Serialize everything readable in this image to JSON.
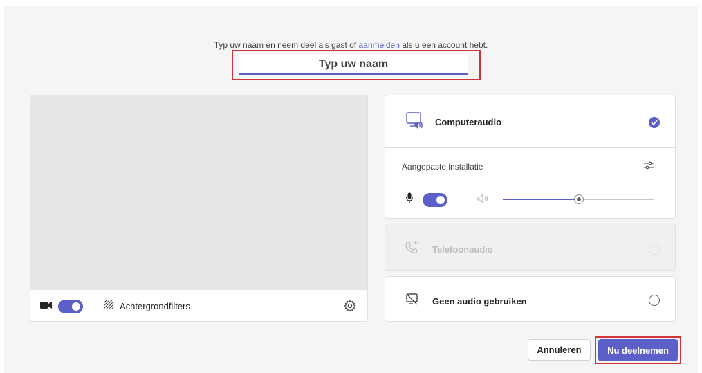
{
  "intro": {
    "before": "Typ uw naam en neem deel als gast of ",
    "link": "aanmelden",
    "after": " als u een account hebt."
  },
  "name_input": {
    "placeholder": "Typ uw naam",
    "value": ""
  },
  "video": {
    "camera_toggle_on": true,
    "background_filters_label": "Achtergrondfilters"
  },
  "audio": {
    "computer": {
      "label": "Computeraudio",
      "selected": true
    },
    "custom_setup_label": "Aangepaste installatie",
    "mic_toggle_on": true,
    "speaker_volume": 0.5,
    "phone": {
      "label": "Telefoonaudio",
      "disabled": true
    },
    "none": {
      "label": "Geen audio gebruiken",
      "selected": false
    }
  },
  "buttons": {
    "cancel": "Annuleren",
    "join": "Nu deelnemen"
  },
  "colors": {
    "accent": "#5b5fc7",
    "highlight_border": "#d13438",
    "panel_bg": "#f5f5f5"
  }
}
